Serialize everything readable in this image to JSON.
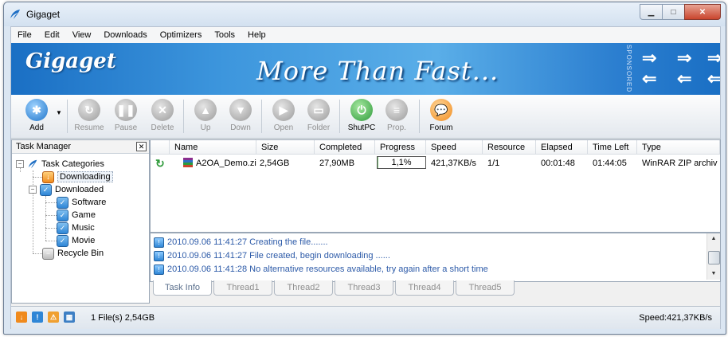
{
  "window": {
    "title": "Gigaget"
  },
  "menu": [
    "File",
    "Edit",
    "View",
    "Downloads",
    "Optimizers",
    "Tools",
    "Help"
  ],
  "banner": {
    "logo": "Gigaget",
    "slogan": "More Than Fast...",
    "sponsored": "SPONSORED"
  },
  "toolbar": {
    "add": "Add",
    "resume": "Resume",
    "pause": "Pause",
    "delete": "Delete",
    "up": "Up",
    "down": "Down",
    "open": "Open",
    "folder": "Folder",
    "shutpc": "ShutPC",
    "prop": "Prop.",
    "forum": "Forum"
  },
  "task_manager": {
    "title": "Task Manager",
    "root": "Task Categories",
    "downloading": "Downloading",
    "downloaded": "Downloaded",
    "categories": [
      "Software",
      "Game",
      "Music",
      "Movie"
    ],
    "recycle": "Recycle Bin"
  },
  "columns": [
    "Name",
    "Size",
    "Completed",
    "Progress",
    "Speed",
    "Resource",
    "Elapsed",
    "Time Left",
    "Type"
  ],
  "rows": [
    {
      "name": "A2OA_Demo.zi",
      "size": "2,54GB",
      "completed": "27,90MB",
      "progress": "1,1%",
      "progress_value": 1.1,
      "speed": "421,37KB/s",
      "resource": "1/1",
      "elapsed": "00:01:48",
      "time_left": "01:44:05",
      "type": "WinRAR ZIP archiv"
    }
  ],
  "log": [
    "2010.09.06 11:41:27 Creating the file.......",
    "2010.09.06 11:41:27 File created, begin downloading ......",
    "2010.09.06 11:41:28 No alternative resources available, try again after a short time"
  ],
  "tabs": [
    "Task Info",
    "Thread1",
    "Thread2",
    "Thread3",
    "Thread4",
    "Thread5"
  ],
  "status": {
    "files": "1 File(s) 2,54GB",
    "speed": "Speed:421,37KB/s"
  },
  "colors": {
    "accent": "#2f86d6",
    "banner": "#3d96dd",
    "log_text": "#2c5aa8"
  }
}
